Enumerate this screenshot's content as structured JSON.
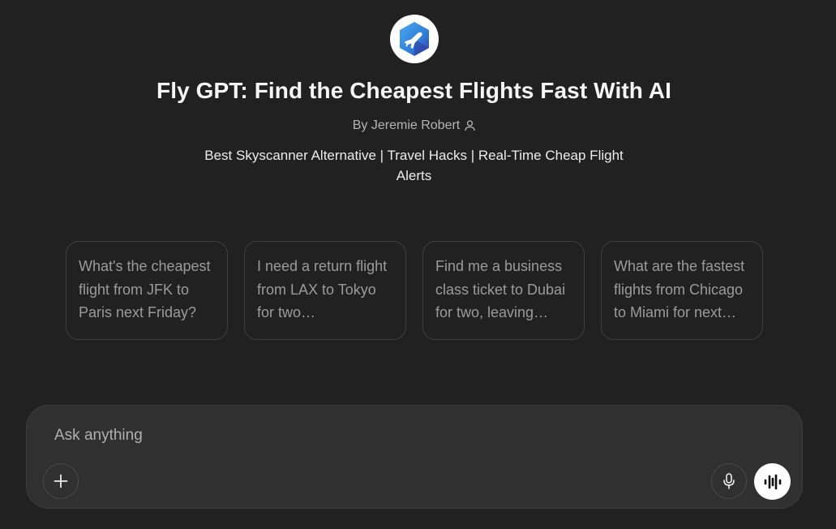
{
  "gpt": {
    "logo_icon": "airplane-logo-icon",
    "title": "Fly GPT: Find the Cheapest Flights Fast With AI",
    "byline": "By Jeremie Robert",
    "author_icon": "person-icon",
    "description": "Best Skyscanner Alternative | Travel Hacks | Real-Time Cheap Flight Alerts"
  },
  "suggestions": [
    {
      "text": "What's the cheapest flight from JFK to Paris next Friday?"
    },
    {
      "text": "I need a return flight from LAX to Tokyo for two…"
    },
    {
      "text": "Find me a business class ticket to Dubai for two, leaving…"
    },
    {
      "text": "What are the fastest flights from Chicago to Miami for next…"
    }
  ],
  "composer": {
    "placeholder": "Ask anything",
    "value": "",
    "add_icon": "plus-icon",
    "mic_icon": "microphone-icon",
    "voice_icon": "voice-mode-icon"
  },
  "colors": {
    "background": "#212121",
    "composer_bg": "#303030",
    "logo_blue": "#2f7fd6"
  }
}
